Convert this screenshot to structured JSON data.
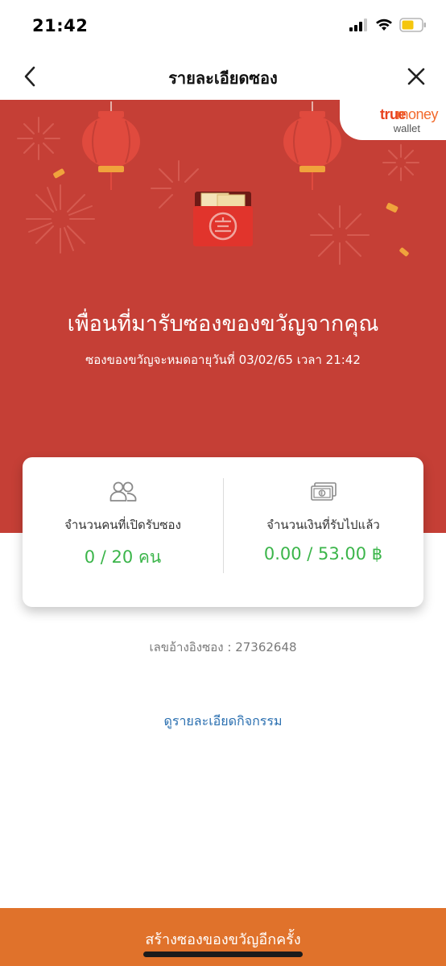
{
  "status_bar": {
    "time": "21:42",
    "icons": [
      "cellular-signal-icon",
      "wifi-icon",
      "battery-icon"
    ]
  },
  "nav": {
    "title": "รายละเอียดซอง",
    "back_icon": "chevron-left-icon",
    "close_icon": "close-icon"
  },
  "hero": {
    "background_color": "#c53f36",
    "brand": {
      "true": "true",
      "money": "money",
      "wallet": "wallet"
    },
    "envelope_icon": "red-envelope-icon",
    "heading": "เพื่อนที่มารับซองของขวัญจากคุณ",
    "expiry": "ซองของขวัญจะหมดอายุวันที่ 03/02/65 เวลา 21:42"
  },
  "stats": {
    "opened": {
      "icon": "people-icon",
      "label": "จำนวนคนที่เปิดรับซอง",
      "value": "0 / 20 คน"
    },
    "received": {
      "icon": "banknotes-icon",
      "label": "จำนวนเงินที่รับไปแล้ว",
      "value": "0.00 / 53.00 ฿"
    },
    "value_color": "#3bb54a"
  },
  "reference": {
    "label": "เลขอ้างอิงซอง : ",
    "value": "27362648"
  },
  "activity_link": "ดูรายละเอียดกิจกรรม",
  "bottom_button": {
    "label": "สร้างซองของขวัญอีกครั้ง",
    "color": "#e0722b"
  }
}
